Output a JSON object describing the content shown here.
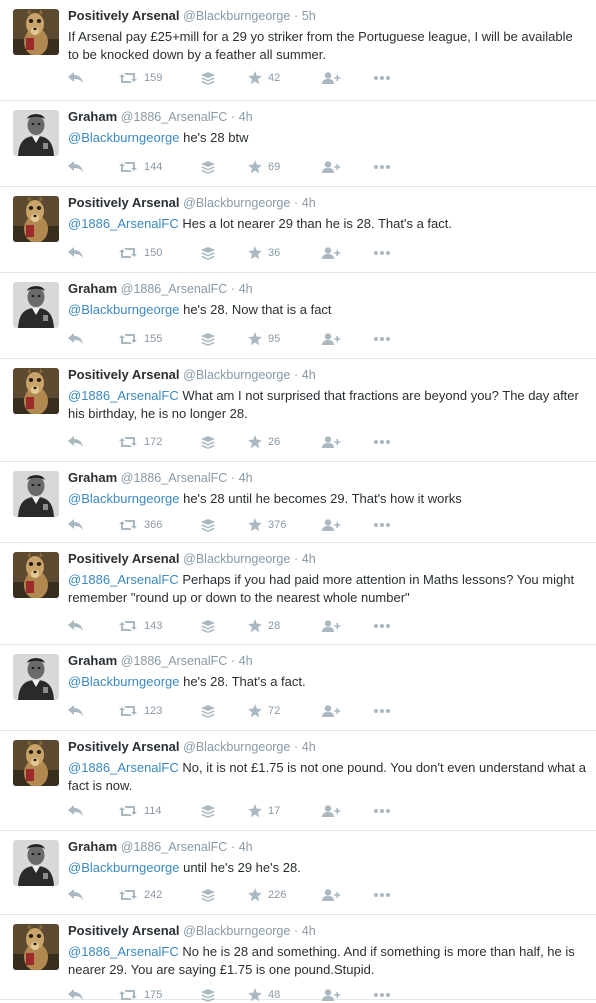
{
  "timeline": [
    {
      "user": "pa",
      "name": "Positively Arsenal",
      "handle": "@Blackburngeorge",
      "time": "5h",
      "mention": "",
      "body": "If Arsenal pay £25+mill for a 29 yo striker from the  Portuguese league, I will be available to be knocked down by a feather all summer.",
      "retweets": "159",
      "favorites": "42"
    },
    {
      "user": "graham",
      "name": "Graham",
      "handle": "@1886_ArsenalFC",
      "time": "4h",
      "mention": "@Blackburngeorge",
      "body": " he's 28 btw",
      "retweets": "144",
      "favorites": "69"
    },
    {
      "user": "pa",
      "name": "Positively Arsenal",
      "handle": "@Blackburngeorge",
      "time": "4h",
      "mention": "@1886_ArsenalFC",
      "body": " Hes a lot nearer 29 than he is 28. That's a fact.",
      "retweets": "150",
      "favorites": "36"
    },
    {
      "user": "graham",
      "name": "Graham",
      "handle": "@1886_ArsenalFC",
      "time": "4h",
      "mention": "@Blackburngeorge",
      "body": " he's 28. Now that is a fact",
      "retweets": "155",
      "favorites": "95"
    },
    {
      "user": "pa",
      "name": "Positively Arsenal",
      "handle": "@Blackburngeorge",
      "time": "4h",
      "mention": "@1886_ArsenalFC",
      "body": "  What am I not surprised that fractions are beyond you? The day after his birthday, he is no longer 28.",
      "retweets": "172",
      "favorites": "26"
    },
    {
      "user": "graham",
      "name": "Graham",
      "handle": "@1886_ArsenalFC",
      "time": "4h",
      "mention": "@Blackburngeorge",
      "body": " he's 28 until he becomes 29. That's how it works",
      "retweets": "366",
      "favorites": "376"
    },
    {
      "user": "pa",
      "name": "Positively Arsenal",
      "handle": "@Blackburngeorge",
      "time": "4h",
      "mention": "@1886_ArsenalFC",
      "body": " Perhaps if you had paid more attention in Maths lessons? You might remember \"round up or down to the nearest whole number\"",
      "retweets": "143",
      "favorites": "28"
    },
    {
      "user": "graham",
      "name": "Graham",
      "handle": "@1886_ArsenalFC",
      "time": "4h",
      "mention": "@Blackburngeorge",
      "body": " he's 28. That's a fact.",
      "retweets": "123",
      "favorites": "72"
    },
    {
      "user": "pa",
      "name": "Positively Arsenal",
      "handle": "@Blackburngeorge",
      "time": "4h",
      "mention": "@1886_ArsenalFC",
      "body": " No, it is not £1.75 is not one pound. You don't even understand what a fact is now.",
      "retweets": "114",
      "favorites": "17"
    },
    {
      "user": "graham",
      "name": "Graham",
      "handle": "@1886_ArsenalFC",
      "time": "4h",
      "mention": "@Blackburngeorge",
      "body": " until he's 29 he's 28.",
      "retweets": "242",
      "favorites": "226"
    },
    {
      "user": "pa",
      "name": "Positively Arsenal",
      "handle": "@Blackburngeorge",
      "time": "4h",
      "mention": "@1886_ArsenalFC",
      "body": " No he is 28 and something. And if something  is more than half, he is nearer 29. You are saying £1.75 is one pound.Stupid.",
      "retweets": "175",
      "favorites": "48"
    }
  ],
  "icons": {
    "reply": "reply-icon",
    "retweet": "retweet-icon",
    "stack": "buffer-stack-icon",
    "favorite": "star-icon",
    "follow": "follow-user-icon",
    "more": "more-dots-icon"
  },
  "colors": {
    "mention": "#3b88c3",
    "meta": "#8899a6",
    "icon": "#aab8c2"
  }
}
